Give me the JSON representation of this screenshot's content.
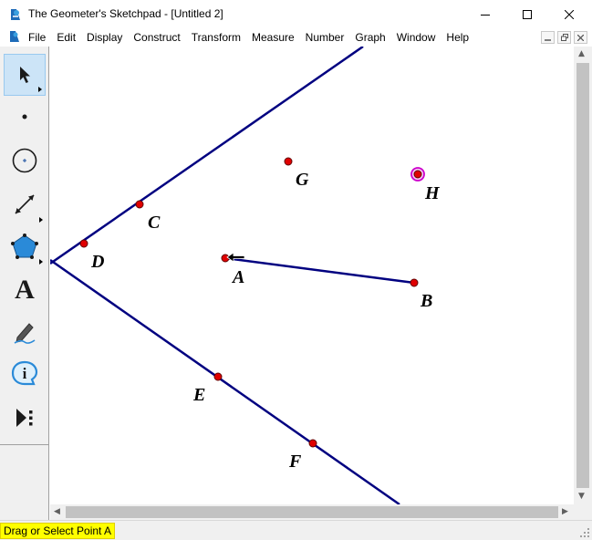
{
  "window": {
    "title": "The Geometer's Sketchpad - [Untitled 2]",
    "controls": [
      "minimize-icon",
      "maximize-icon",
      "close-icon"
    ]
  },
  "menu": {
    "items": [
      "File",
      "Edit",
      "Display",
      "Construct",
      "Transform",
      "Measure",
      "Number",
      "Graph",
      "Window",
      "Help"
    ],
    "mdi_controls": [
      "minimize-icon",
      "restore-icon",
      "close-icon"
    ]
  },
  "toolbox": {
    "tools": [
      {
        "name": "arrow-tool",
        "icon": "arrow-icon",
        "selected": true
      },
      {
        "name": "point-tool",
        "icon": "point-icon"
      },
      {
        "name": "compass-tool",
        "icon": "compass-icon"
      },
      {
        "name": "straightedge-tool",
        "icon": "straightedge-icon"
      },
      {
        "name": "polygon-tool",
        "icon": "polygon-icon"
      },
      {
        "name": "text-tool",
        "icon": "text-icon",
        "glyph": "A"
      },
      {
        "name": "marker-tool",
        "icon": "marker-icon"
      },
      {
        "name": "information-tool",
        "icon": "information-icon",
        "glyph": "i"
      },
      {
        "name": "custom-tool",
        "icon": "custom-tool-icon"
      }
    ]
  },
  "sketch": {
    "colors": {
      "line": "#000080",
      "point": "#e00000",
      "highlight": "#cc00cc"
    },
    "labels": {
      "A": "A",
      "B": "B",
      "C": "C",
      "D": "D",
      "E": "E",
      "F": "F",
      "G": "G",
      "H": "H"
    },
    "selected_point": "H"
  },
  "status": {
    "text": "Drag or Select Point A",
    "highlight_color": "#ffff00"
  }
}
